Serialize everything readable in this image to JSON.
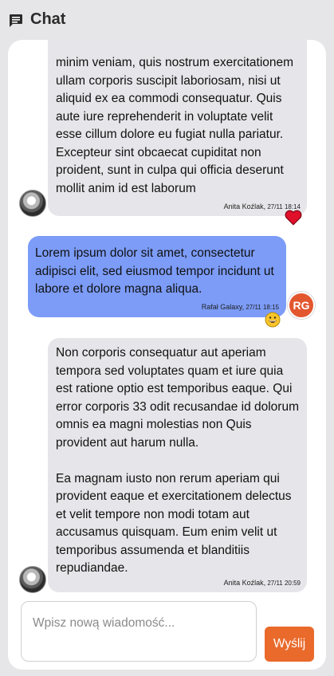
{
  "header": {
    "title": "Chat",
    "icon": "chat-bubble-icon"
  },
  "messages": [
    {
      "direction": "incoming",
      "text": "minim veniam, quis nostrum exercitationem ullam corporis suscipit laboriosam, nisi ut aliquid ex ea commodi consequatur. Quis aute iure reprehenderit in voluptate velit esse cillum dolore eu fugiat nulla pariatur. Excepteur sint obcaecat cupiditat non proident, sunt in culpa qui officia deserunt mollit anim id est laborum",
      "author": "Anita Koźlak,",
      "timestamp": "27/11 18:14",
      "avatar": "photo",
      "reaction": "heart-icon"
    },
    {
      "direction": "outgoing",
      "text": "Lorem ipsum dolor sit amet, consectetur adipisci elit, sed eiusmod tempor incidunt ut labore et dolore magna aliqua.",
      "author": "Rafał Galaxy,",
      "timestamp": "27/11 18:15",
      "avatar_initials": "RG",
      "reaction": "grinning-face-icon"
    },
    {
      "direction": "incoming",
      "text": "Non corporis consequatur aut aperiam tempora sed voluptates quam et iure quia est ratione optio est temporibus eaque. Qui error corporis 33 odit recusandae id dolorum omnis ea magni molestias non Quis provident aut harum nulla.\n\nEa magnam iusto non rerum aperiam qui provident eaque et exercitationem delectus et velit tempore non modi totam aut accusamus quisquam. Eum enim velit ut temporibus assumenda et blanditiis repudiandae.",
      "author": "Anita Koźlak,",
      "timestamp": "27/11 20:59",
      "avatar": "photo"
    }
  ],
  "composer": {
    "placeholder": "Wpisz nową wiadomość...",
    "value": ""
  },
  "send_label": "Wyślij",
  "colors": {
    "accent": "#e96a2b",
    "outgoing_bubble": "#7c9cf8",
    "incoming_bubble": "#e6e6ea",
    "reaction_heart": "#e0102b"
  }
}
